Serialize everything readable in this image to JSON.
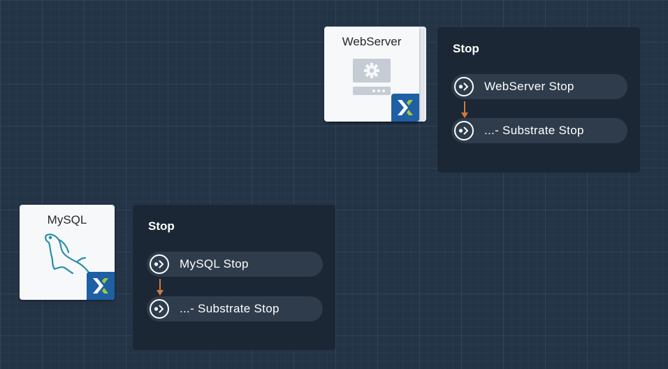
{
  "colors": {
    "background": "#243447",
    "panel": "#1b2735",
    "task_pill": "#2e3c4c",
    "arrow": "#d17a3c",
    "badge": "#1f5fa3",
    "badge_mark_light": "#ffffff",
    "badge_mark_green": "#9fc93c",
    "mysql_logo": "#2b8ea8"
  },
  "services": [
    {
      "name": "WebServer",
      "icon": "server-gear-icon",
      "badge_icon": "nutanix-x-icon",
      "stacked": true
    },
    {
      "name": "MySQL",
      "icon": "mysql-dolphin-icon",
      "badge_icon": "nutanix-x-icon",
      "stacked": false
    }
  ],
  "panels": [
    {
      "title": "Stop",
      "tasks": [
        {
          "label": "WebServer Stop",
          "icon": "task-run-icon"
        },
        {
          "label": "...- Substrate Stop",
          "icon": "task-run-icon"
        }
      ]
    },
    {
      "title": "Stop",
      "tasks": [
        {
          "label": "MySQL Stop",
          "icon": "task-run-icon"
        },
        {
          "label": "...- Substrate Stop",
          "icon": "task-run-icon"
        }
      ]
    }
  ]
}
